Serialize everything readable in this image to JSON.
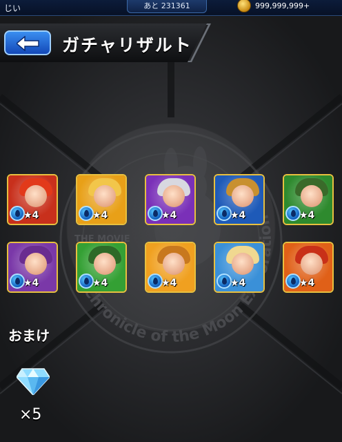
{
  "header": {
    "user_name": "じい",
    "remaining_text": "あと 231361",
    "coins": "999,999,999+"
  },
  "titlebar": {
    "title": "ガチャリザルト"
  },
  "results": [
    {
      "rarity": "★4",
      "frame": "#e8c040",
      "bg": "#c8301c",
      "hair": "#e23a1a"
    },
    {
      "rarity": "★4",
      "frame": "#e8c040",
      "bg": "#e8a018",
      "hair": "#f2c64a"
    },
    {
      "rarity": "★4",
      "frame": "#e8c040",
      "bg": "#7a30b8",
      "hair": "#d8d8e0"
    },
    {
      "rarity": "★4",
      "frame": "#e8c040",
      "bg": "#1e5ab8",
      "hair": "#c89030"
    },
    {
      "rarity": "★4",
      "frame": "#e8c040",
      "bg": "#2e8a2e",
      "hair": "#3a6a2a"
    },
    {
      "rarity": "★4",
      "frame": "#e8c040",
      "bg": "#7a38a8",
      "hair": "#6a2c90"
    },
    {
      "rarity": "★4",
      "frame": "#e8c040",
      "bg": "#34a034",
      "hair": "#2e6a28"
    },
    {
      "rarity": "★4",
      "frame": "#e8c040",
      "bg": "#f0a020",
      "hair": "#c8781e"
    },
    {
      "rarity": "★4",
      "frame": "#e8c040",
      "bg": "#3a90d8",
      "hair": "#f0d890"
    },
    {
      "rarity": "★4",
      "frame": "#e8c040",
      "bg": "#e06018",
      "hair": "#c83018"
    }
  ],
  "bonus": {
    "label": "おまけ",
    "item_icon": "diamond-icon",
    "count": "×5"
  },
  "background": {
    "emblem_text": "Chronicle of the Moon Exploration",
    "emblem_subtext": "THE MOVIE"
  }
}
